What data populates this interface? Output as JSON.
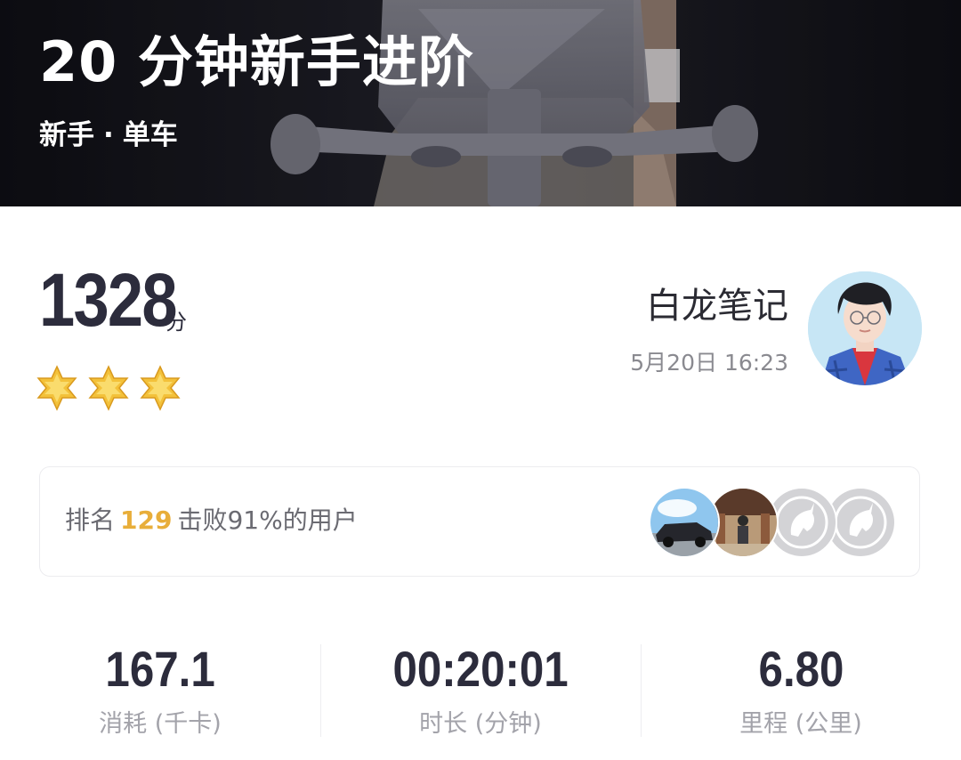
{
  "workout": {
    "title": "20 分钟新手进阶",
    "level": "新手",
    "separator": "·",
    "type": "单车"
  },
  "score": {
    "value": "1328",
    "unit": "分",
    "stars": 3
  },
  "user": {
    "name": "白龙笔记",
    "time": "5月20日 16:23"
  },
  "ranking": {
    "prefix": "排名",
    "rank": "129",
    "suffix": "击败91%的用户"
  },
  "stats": [
    {
      "value": "167.1",
      "label": "消耗 (千卡)"
    },
    {
      "value": "00:20:01",
      "label": "时长 (分钟)"
    },
    {
      "value": "6.80",
      "label": "里程 (公里)"
    }
  ],
  "colors": {
    "accent": "#e8ae3a",
    "hero_bg": "#15151c",
    "star": "#f3c13a"
  }
}
